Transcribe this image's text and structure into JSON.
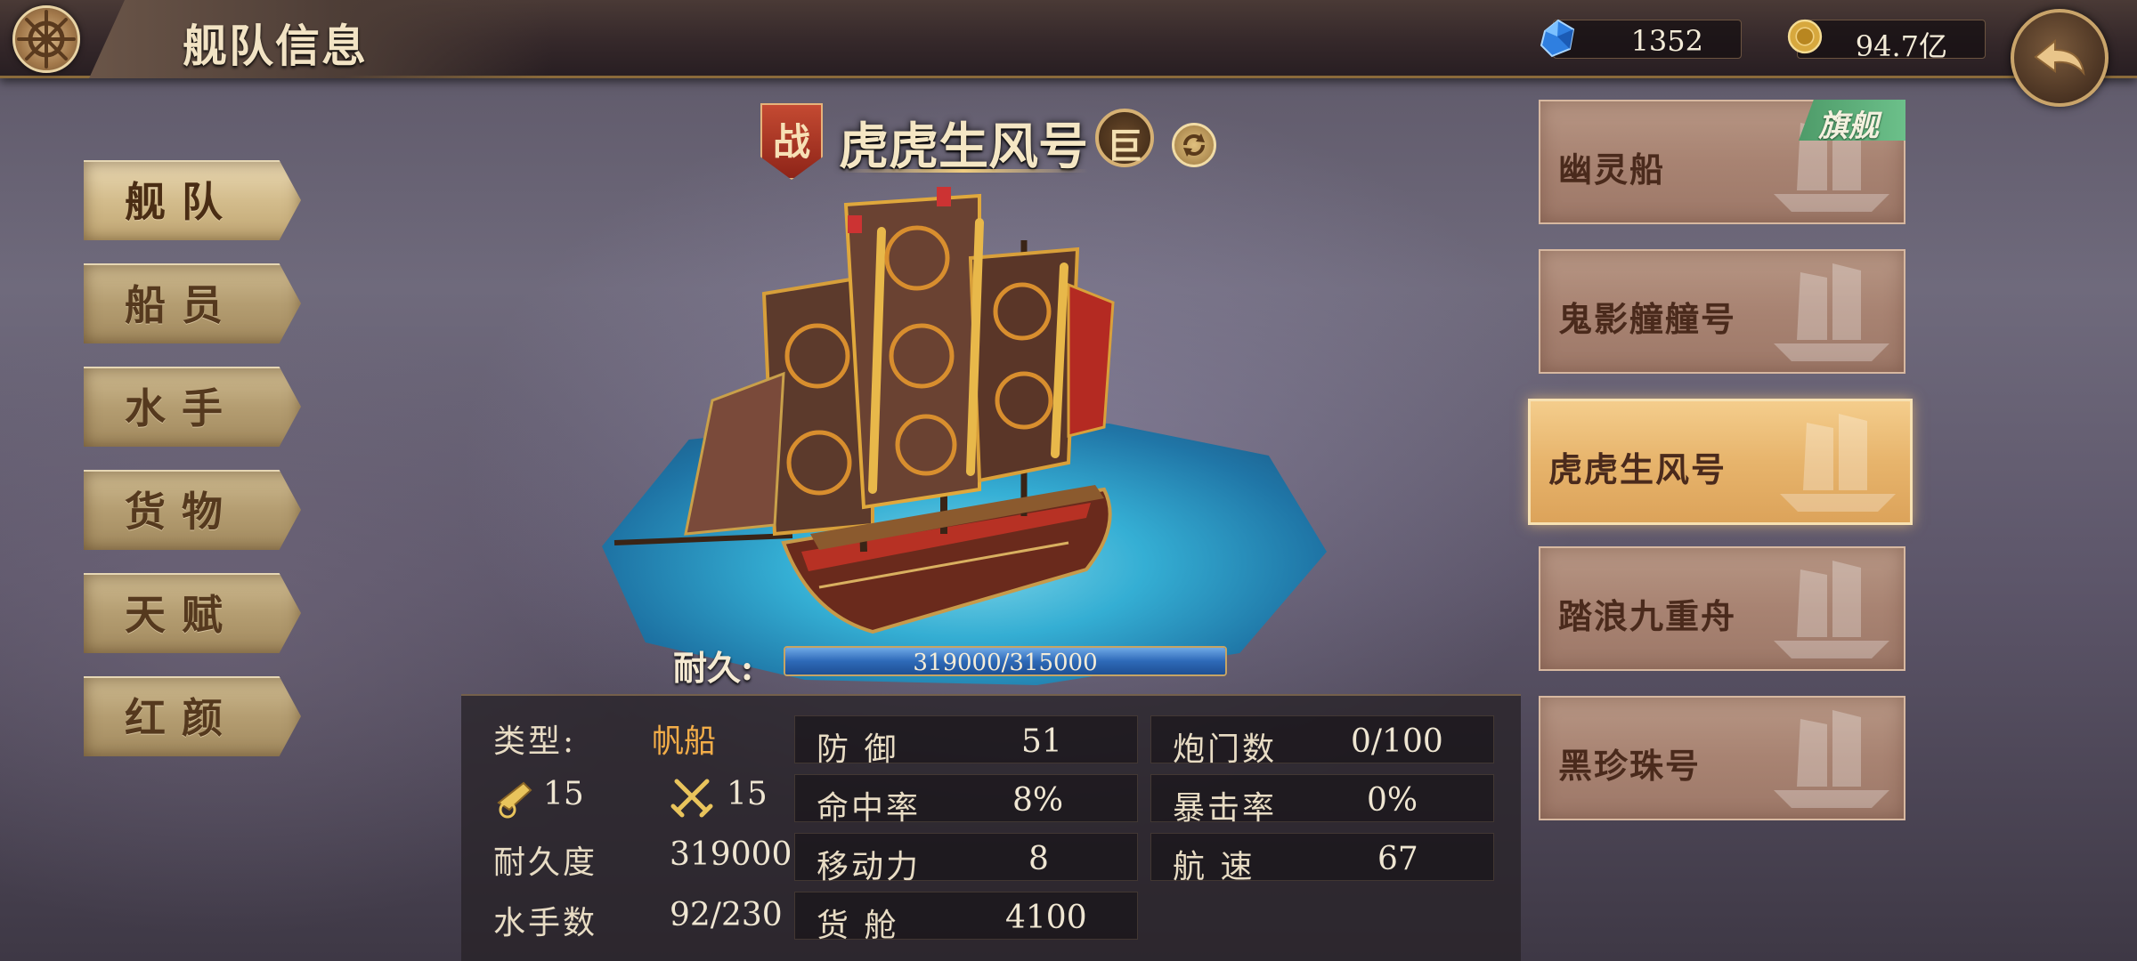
{
  "header": {
    "title": "舰队信息",
    "gems": "1352",
    "gold": "94.7亿"
  },
  "menu": {
    "items": [
      {
        "label": "舰队",
        "active": true
      },
      {
        "label": "船员",
        "active": false
      },
      {
        "label": "水手",
        "active": false
      },
      {
        "label": "货物",
        "active": false
      },
      {
        "label": "天赋",
        "active": false
      },
      {
        "label": "红颜",
        "active": false
      }
    ]
  },
  "ship": {
    "war_badge": "战",
    "name": "虎虎生风号",
    "size_badge": "巨",
    "durability_label": "耐久:",
    "durability_text": "319000/315000",
    "durability_fraction": 1.0
  },
  "stats": {
    "type_label": "类型:",
    "type_value": "帆船",
    "cannon_value": "15",
    "melee_value": "15",
    "endurance_label": "耐久度",
    "endurance_value": "319000",
    "sailors_label": "水手数",
    "sailors_value": "92/230",
    "defense_label": "防 御",
    "defense_value": "51",
    "hit_label": "命中率",
    "hit_value": "8%",
    "move_label": "移动力",
    "move_value": "8",
    "cargo_label": "货 舱",
    "cargo_value": "4100",
    "gunports_label": "炮门数",
    "gunports_value": "0/100",
    "crit_label": "暴击率",
    "crit_value": "0%",
    "speed_label": "航 速",
    "speed_value": "67"
  },
  "ship_list": {
    "flag_tag": "旗舰",
    "items": [
      {
        "name": "幽灵船",
        "flagship": true,
        "active": false
      },
      {
        "name": "鬼影艟艟号",
        "flagship": false,
        "active": false
      },
      {
        "name": "虎虎生风号",
        "flagship": false,
        "active": true
      },
      {
        "name": "踏浪九重舟",
        "flagship": false,
        "active": false
      },
      {
        "name": "黑珍珠号",
        "flagship": false,
        "active": false
      }
    ]
  },
  "icons": {
    "wheel": "ship-wheel-icon",
    "gem": "blue-gem-icon",
    "coin": "gold-coin-icon",
    "back": "back-arrow-icon",
    "refresh": "refresh-icon",
    "cannon": "cannon-icon",
    "melee": "crossed-swords-icon"
  },
  "colors": {
    "accent_gold": "#f0cd80",
    "type_orange": "#f2ad48",
    "flag_green": "#5fb07d",
    "active_card": "#e7b46c"
  }
}
